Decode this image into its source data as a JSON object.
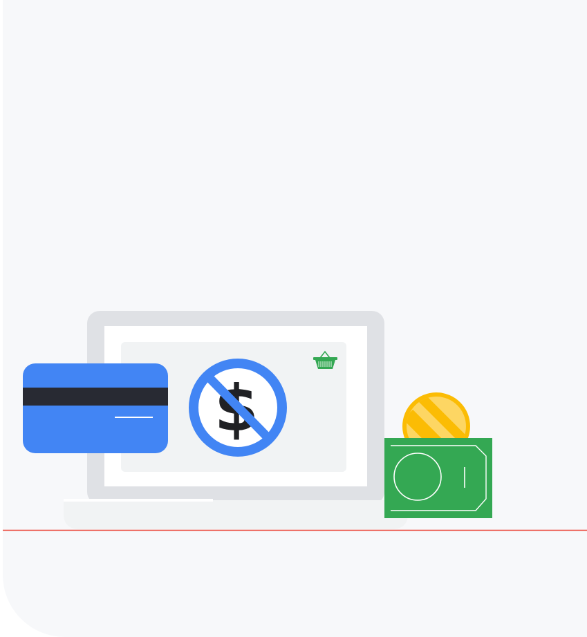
{
  "illustration": {
    "description_icons": [
      "laptop-icon",
      "credit-card-icon",
      "no-dollar-icon",
      "shopping-basket-icon",
      "coin-icon",
      "banknote-icon"
    ]
  },
  "colors": {
    "background": "#f7f8fa",
    "laptop_frame": "#dfe1e5",
    "laptop_screen": "#ffffff",
    "screen_panel": "#f1f3f4",
    "card_blue": "#4285f4",
    "card_stripe": "#282a33",
    "prohibit_blue": "#4285f4",
    "dollar_dark": "#202124",
    "basket_green": "#34a853",
    "note_green": "#34a853",
    "coin_yellow": "#fbbc04",
    "coin_light": "#fdd663",
    "divider_red": "#ea4335"
  }
}
